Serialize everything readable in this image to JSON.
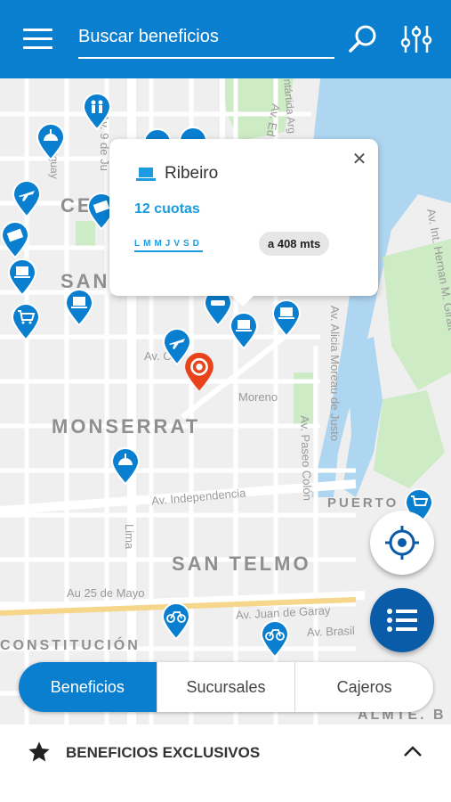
{
  "header": {
    "search_placeholder": "Buscar beneficios",
    "menu_icon": "hamburger-menu-icon",
    "search_icon": "search-icon",
    "filter_icon": "filter-sliders-icon"
  },
  "colors": {
    "brand": "#0a7fd0",
    "brand_dark": "#0a5ca8",
    "accent": "#1b9be0",
    "selected_pin": "#e8431b"
  },
  "map": {
    "districts": [
      "CE",
      "SAN",
      "MONSERRAT",
      "SAN TELMO",
      "PUERTO M",
      "CONSTITUCIÓN",
      "ALMTE. B"
    ],
    "streets": [
      "Av. 9 de Ju",
      "Av. Ed",
      "ntártida Arg",
      "Av. Int. Hernan M. Giralt",
      "Av. Alicia Moreau de Justo",
      "Av. Paseo Colón",
      "Moreno",
      "Av. Independencia",
      "Lima",
      "Au 25 de Mayo",
      "Av. Juan de Garay",
      "Av. Brasil",
      "Av. Co",
      "uguay"
    ]
  },
  "popup": {
    "title": "Ribeiro",
    "cuotas": "12 cuotas",
    "days": "LMMJVSD",
    "distance": "a 408 mts",
    "icon": "laptop-icon",
    "close_icon": "close-icon"
  },
  "segmented": {
    "tabs": [
      {
        "label": "Beneficios",
        "active": true
      },
      {
        "label": "Sucursales",
        "active": false
      },
      {
        "label": "Cajeros",
        "active": false
      }
    ]
  },
  "bottom_panel": {
    "title": "BENEFICIOS EXCLUSIVOS",
    "icon": "star-icon",
    "toggle_icon": "chevron-up-icon"
  }
}
